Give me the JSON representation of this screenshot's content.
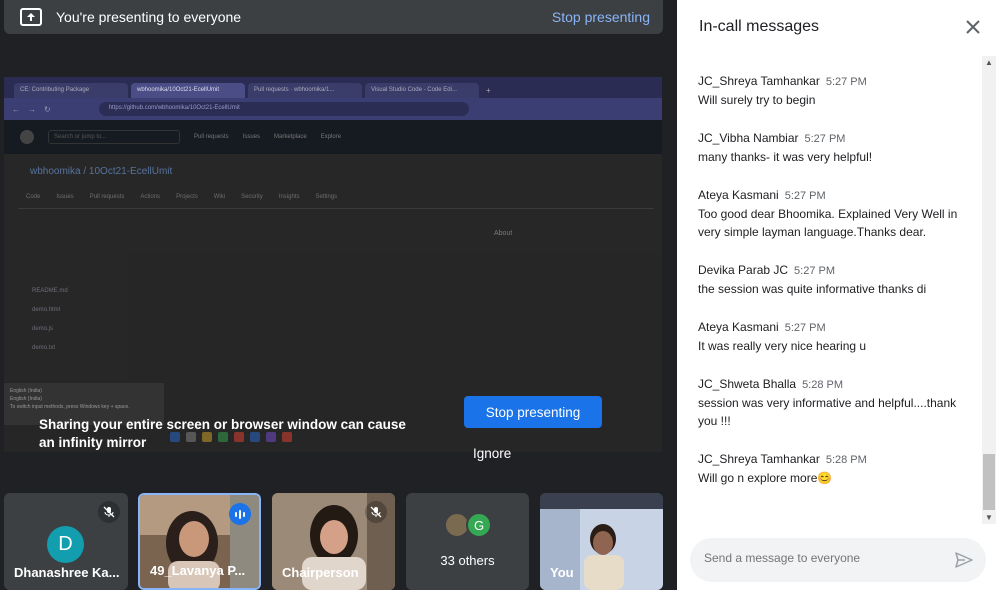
{
  "banner": {
    "title": "You're presenting to everyone",
    "stop_link": "Stop presenting"
  },
  "shared_screen": {
    "browser_tabs": [
      {
        "label": "CE: Contributing Package"
      },
      {
        "label": "wbhoomika/10Oct21-EcellUmit",
        "active": true
      },
      {
        "label": "Pull requests · wbhoomika/1..."
      },
      {
        "label": "Visual Studio Code - Code Edi..."
      }
    ],
    "url": "https://github.com/wbhoomika/10Oct21-EcellUmit",
    "gh_nav": [
      "Search or jump to...",
      "Pull requests",
      "Issues",
      "Marketplace",
      "Explore"
    ],
    "repo_title": "wbhoomika / 10Oct21-EcellUmit",
    "repo_tabs": [
      "Code",
      "Issues",
      "Pull requests",
      "Actions",
      "Projects",
      "Wiki",
      "Security",
      "Insights",
      "Settings"
    ],
    "files": [
      "README.md",
      "demo.html",
      "demo.js",
      "demo.txt"
    ],
    "about": "About",
    "tooltip": [
      "English (India)",
      "English (India)",
      "To switch input methods, press Windows key + space."
    ]
  },
  "warning": {
    "text": "Sharing your entire screen or browser window can cause an infinity mirror",
    "stop_button": "Stop presenting",
    "ignore": "Ignore"
  },
  "tiles": [
    {
      "name": "Dhanashree Ka...",
      "initial": "D"
    },
    {
      "name": "49_Lavanya P..."
    },
    {
      "name": "Chairperson"
    },
    {
      "name": "33 others",
      "initial": "G"
    },
    {
      "name": "You"
    }
  ],
  "panel": {
    "title": "In-call messages",
    "messages": [
      {
        "sender": "JC_Shreya Tamhankar",
        "time": "5:27 PM",
        "text": "Will surely try to begin"
      },
      {
        "sender": "JC_Vibha Nambiar",
        "time": "5:27 PM",
        "text": "many thanks- it was very helpful!"
      },
      {
        "sender": "Ateya Kasmani",
        "time": "5:27 PM",
        "text": "Too good dear Bhoomika. Explained Very Well in very simple layman language.Thanks dear."
      },
      {
        "sender": "Devika Parab JC",
        "time": "5:27 PM",
        "text": "the session was quite informative thanks di"
      },
      {
        "sender": "Ateya Kasmani",
        "time": "5:27 PM",
        "text": "It was really very nice hearing u"
      },
      {
        "sender": "JC_Shweta Bhalla",
        "time": "5:28 PM",
        "text": "session was very informative and helpful....thank you !!!"
      },
      {
        "sender": "JC_Shreya Tamhankar",
        "time": "5:28 PM",
        "text": "Will go n explore more😊"
      }
    ],
    "composer_placeholder": "Send a message to everyone"
  },
  "colors": {
    "accent": "#1a73e8",
    "link": "#8ab4f8",
    "background": "#202124",
    "tile": "#3c4043"
  }
}
